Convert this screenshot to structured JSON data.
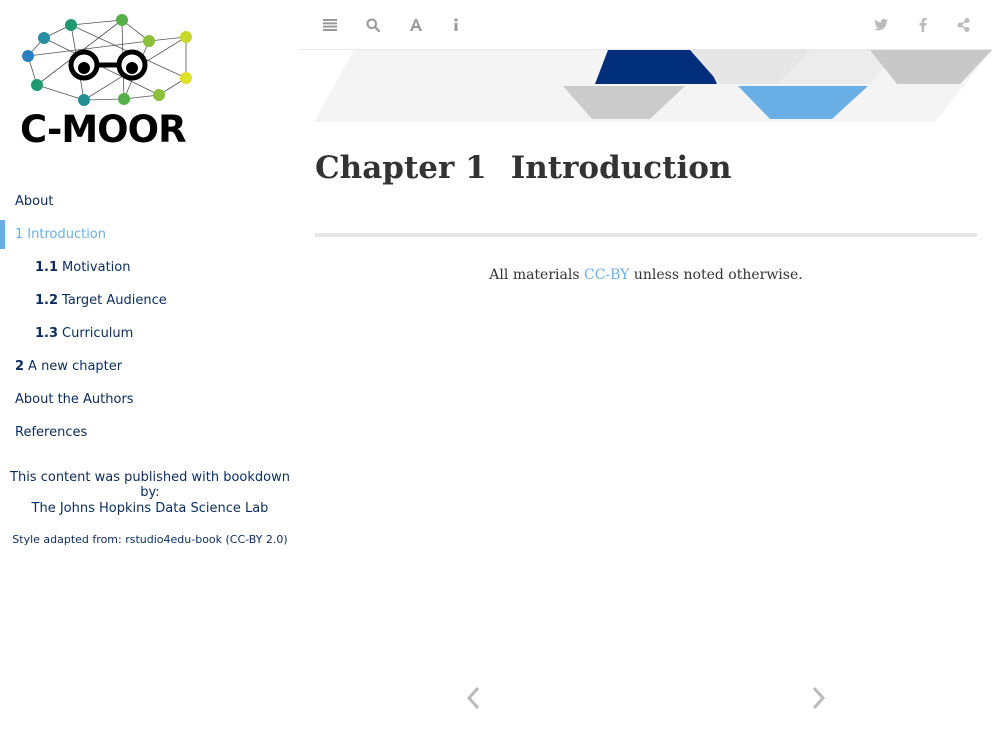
{
  "sidebar": {
    "logo_text": "C-MOOR",
    "nav": [
      {
        "num": "",
        "label": "About"
      },
      {
        "num": "1",
        "label": "Introduction"
      },
      {
        "num": "1.1",
        "label": "Motivation"
      },
      {
        "num": "1.2",
        "label": "Target Audience"
      },
      {
        "num": "1.3",
        "label": "Curriculum"
      },
      {
        "num": "2",
        "label": "A new chapter"
      },
      {
        "num": "",
        "label": "About the Authors"
      },
      {
        "num": "",
        "label": "References"
      }
    ],
    "published_by": "This content was published with bookdown by:",
    "publisher": "The Johns Hopkins Data Science Lab",
    "style_note": "Style adapted from: rstudio4edu-book (CC-BY 2.0)"
  },
  "toolbar": {
    "left_icons": [
      "list-icon",
      "search-icon",
      "font-icon",
      "info-icon"
    ],
    "right_icons": [
      "twitter-icon",
      "facebook-icon",
      "share-icon"
    ]
  },
  "main": {
    "chapter_label": "Chapter 1",
    "chapter_title": "Introduction",
    "license_prefix": "All materials ",
    "license_link": "CC-BY",
    "license_suffix": " unless noted otherwise."
  },
  "colors": {
    "accent": "#6aaee6",
    "navy": "#002e7a",
    "nav_text": "#0b2c5e",
    "heading": "#333333"
  }
}
